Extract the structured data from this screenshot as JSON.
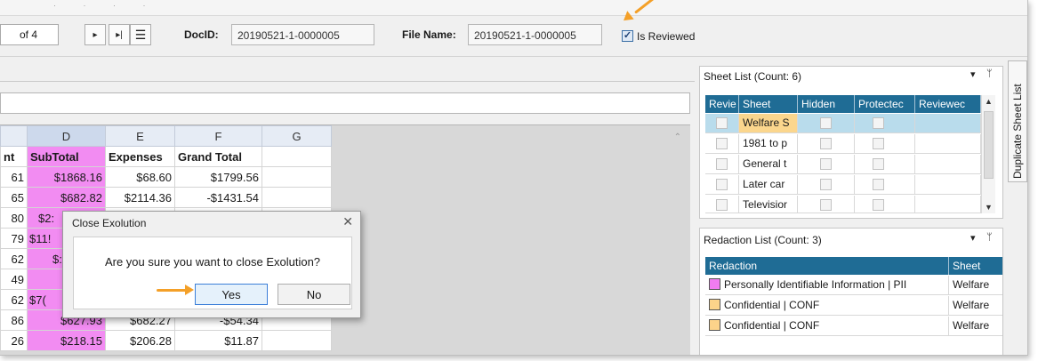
{
  "toolbar": {
    "page_of": "of 4",
    "next_icon": "play-icon",
    "last_icon": "skip-end-icon",
    "menu_icon": "hamburger-icon",
    "docid_label": "DocID:",
    "docid_value": "20190521-1-0000005",
    "filename_label": "File Name:",
    "filename_value": "20190521-1-0000005",
    "is_reviewed_label": "Is Reviewed",
    "is_reviewed_checked": true
  },
  "spreadsheet": {
    "columns": [
      "D",
      "E",
      "F",
      "G"
    ],
    "partial_col_header": "",
    "header_row": {
      "c": "nt",
      "d": "SubTotal",
      "e": "Expenses",
      "f": "Grand Total",
      "g": ""
    },
    "rows": [
      {
        "c": "61",
        "d": "$1868.16",
        "e": "$68.60",
        "f": "$1799.56"
      },
      {
        "c": "65",
        "d": "$682.82",
        "e": "$2114.36",
        "f": "-$1431.54"
      },
      {
        "c": "80",
        "d": "$2:",
        "e": "",
        "f": ""
      },
      {
        "c": "79",
        "d": "$11!",
        "e": "",
        "f": ""
      },
      {
        "c": "62",
        "d": "$:",
        "e": "",
        "f": ""
      },
      {
        "c": "49",
        "d": "",
        "e": "",
        "f": ""
      },
      {
        "c": "62",
        "d": "$7(",
        "e": "",
        "f": ""
      },
      {
        "c": "86",
        "d": "$627.93",
        "e": "$682.27",
        "f": "-$54.34"
      },
      {
        "c": "26",
        "d": "$218.15",
        "e": "$206.28",
        "f": "$11.87"
      }
    ]
  },
  "dialog": {
    "title": "Close Exolution",
    "message": "Are you sure you want to close Exolution?",
    "yes_label": "Yes",
    "no_label": "No"
  },
  "sheet_list": {
    "title": "Sheet List (Count: 6)",
    "dropdown_icon": "▾",
    "pin_icon": "pin-icon",
    "columns": [
      "Revie",
      "Sheet",
      "Hidden",
      "Protectec",
      "Reviewec"
    ],
    "rows": [
      {
        "sheet": "Welfare S"
      },
      {
        "sheet": "1981 to p"
      },
      {
        "sheet": "General t"
      },
      {
        "sheet": "Later car"
      },
      {
        "sheet": "Televisior"
      }
    ]
  },
  "redaction_list": {
    "title": "Redaction List (Count: 3)",
    "columns": [
      "Redaction",
      "Sheet"
    ],
    "rows": [
      {
        "label": "Personally Identifiable Information | PII",
        "sheet": "Welfare",
        "color": "#f07cf0"
      },
      {
        "label": "Confidential | CONF",
        "sheet": "Welfare",
        "color": "#fcd38a"
      },
      {
        "label": "Confidential | CONF",
        "sheet": "Welfare",
        "color": "#fcd38a"
      }
    ]
  },
  "side_tab": {
    "label": "Duplicate Sheet List"
  },
  "colors": {
    "accent": "#1f6c95",
    "highlight": "#f28cf2",
    "arrow": "#f4a028"
  }
}
